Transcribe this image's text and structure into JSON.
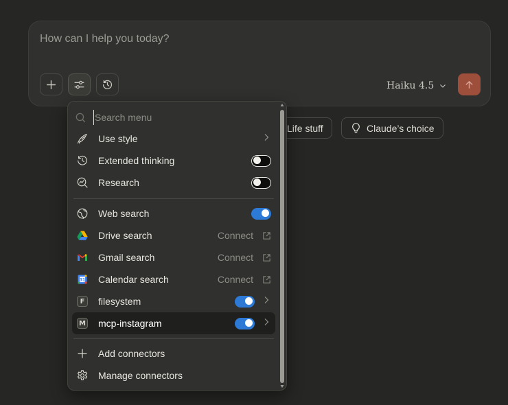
{
  "composer": {
    "placeholder": "How can I help you today?",
    "model": "Haiku 4.5",
    "buttons": [
      "add-icon",
      "sliders-icon",
      "history-icon"
    ]
  },
  "chips": [
    {
      "label": "Life stuff",
      "icon": ""
    },
    {
      "label": "Claude’s choice",
      "icon": "lightbulb-icon"
    }
  ],
  "menu": {
    "search_placeholder": "Search menu",
    "items": [
      {
        "label": "Use style",
        "icon": "pen-nib-icon",
        "control": "chevron"
      },
      {
        "label": "Extended thinking",
        "icon": "clock-icon",
        "control": "toggle",
        "on": false
      },
      {
        "label": "Research",
        "icon": "research-icon",
        "control": "toggle",
        "on": false
      },
      {
        "label": "Web search",
        "icon": "globe-icon",
        "control": "toggle",
        "on": true
      },
      {
        "label": "Drive search",
        "icon": "google-drive-icon",
        "control": "connect",
        "action": "Connect"
      },
      {
        "label": "Gmail search",
        "icon": "gmail-icon",
        "control": "connect",
        "action": "Connect"
      },
      {
        "label": "Calendar search",
        "icon": "google-calendar-icon",
        "control": "connect",
        "action": "Connect"
      },
      {
        "label": "filesystem",
        "icon": "letter-f-icon",
        "badge": "F",
        "control": "toggle-chevron",
        "on": true
      },
      {
        "label": "mcp-instagram",
        "icon": "letter-m-icon",
        "badge": "M",
        "control": "toggle-chevron",
        "on": true,
        "highlighted": true
      },
      {
        "label": "Add connectors",
        "icon": "plus-icon",
        "control": "none"
      },
      {
        "label": "Manage connectors",
        "icon": "gear-icon",
        "control": "none"
      }
    ]
  },
  "colors": {
    "background": "#262624",
    "surface": "#30302e",
    "accent_send": "#9d4f3c",
    "toggle_on": "#2d7ad6"
  }
}
